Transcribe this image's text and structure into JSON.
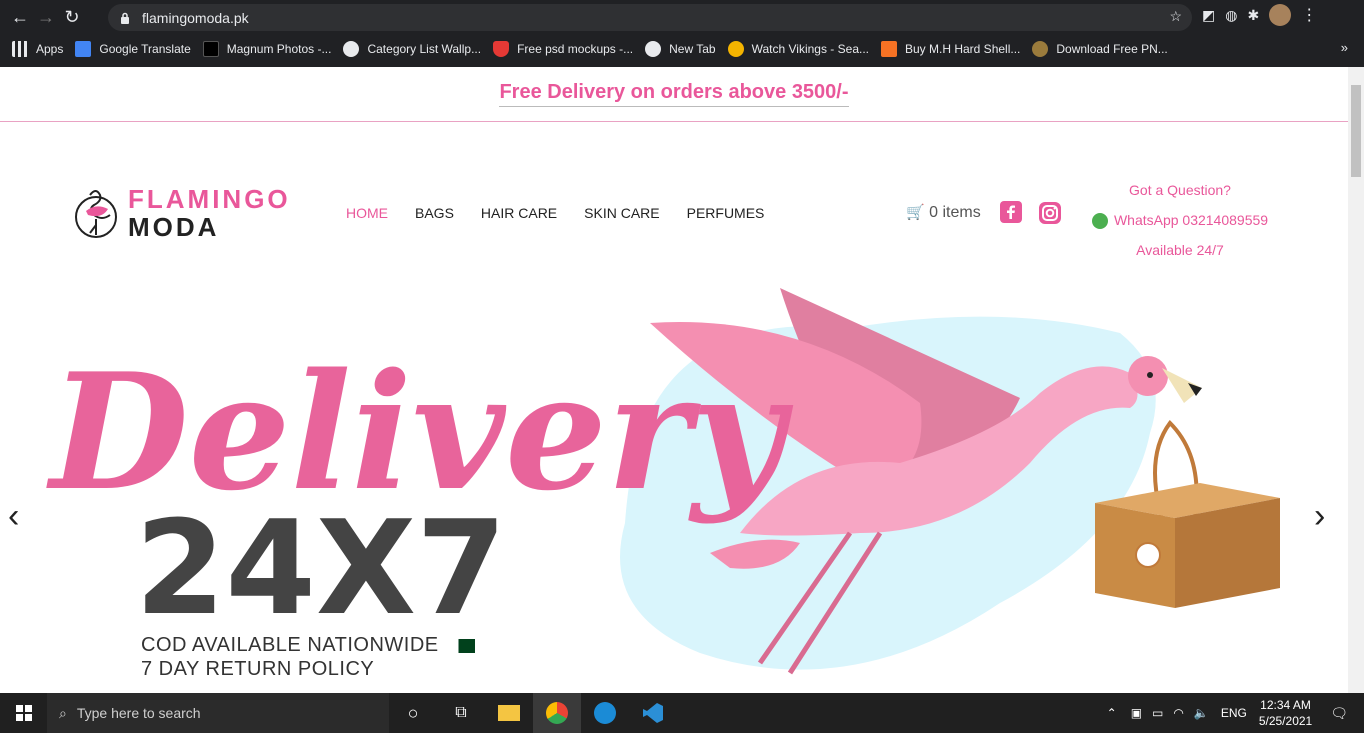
{
  "browser": {
    "url": "flamingomoda.pk",
    "bookmarks": [
      {
        "label": "Apps",
        "icon": "apps-grid-icon",
        "color": "#e8eaed"
      },
      {
        "label": "Google Translate",
        "icon": "google-translate-icon",
        "color": "#4285f4"
      },
      {
        "label": "Magnum Photos -...",
        "icon": "magnum-icon",
        "color": "#000000"
      },
      {
        "label": "Category List Wallp...",
        "icon": "globe-icon",
        "color": "#e8eaed"
      },
      {
        "label": "Free psd mockups -...",
        "icon": "strawberry-icon",
        "color": "#e53935"
      },
      {
        "label": "New Tab",
        "icon": "globe-icon",
        "color": "#e8eaed"
      },
      {
        "label": "Watch Vikings - Sea...",
        "icon": "s-icon",
        "color": "#f4b400"
      },
      {
        "label": "Buy M.H Hard Shell...",
        "icon": "daraz-icon",
        "color": "#f57224"
      },
      {
        "label": "Download Free PN...",
        "icon": "p-icon",
        "color": "#9a7b3c"
      }
    ]
  },
  "site": {
    "promo": "Free Delivery on orders above 3500/-",
    "logo": {
      "line1": "FLAMINGO",
      "line2": "MODA"
    },
    "nav": [
      "HOME",
      "BAGS",
      "HAIR CARE",
      "SKIN CARE",
      "PERFUMES"
    ],
    "cart": "0 items",
    "contact": {
      "question": "Got a Question?",
      "whatsapp": "WhatsApp 03214089559",
      "availability": "Available 24/7"
    },
    "hero": {
      "script": "Delivery",
      "big": "24X7",
      "line1": "COD AVAILABLE NATIONWIDE",
      "line2": "7 DAY RETURN POLICY"
    },
    "colors": {
      "brand": "#e9579a",
      "dark": "#444444",
      "sky": "#d9f5fc"
    }
  },
  "taskbar": {
    "search_placeholder": "Type here to search",
    "language": "ENG",
    "time": "12:34 AM",
    "date": "5/25/2021"
  }
}
